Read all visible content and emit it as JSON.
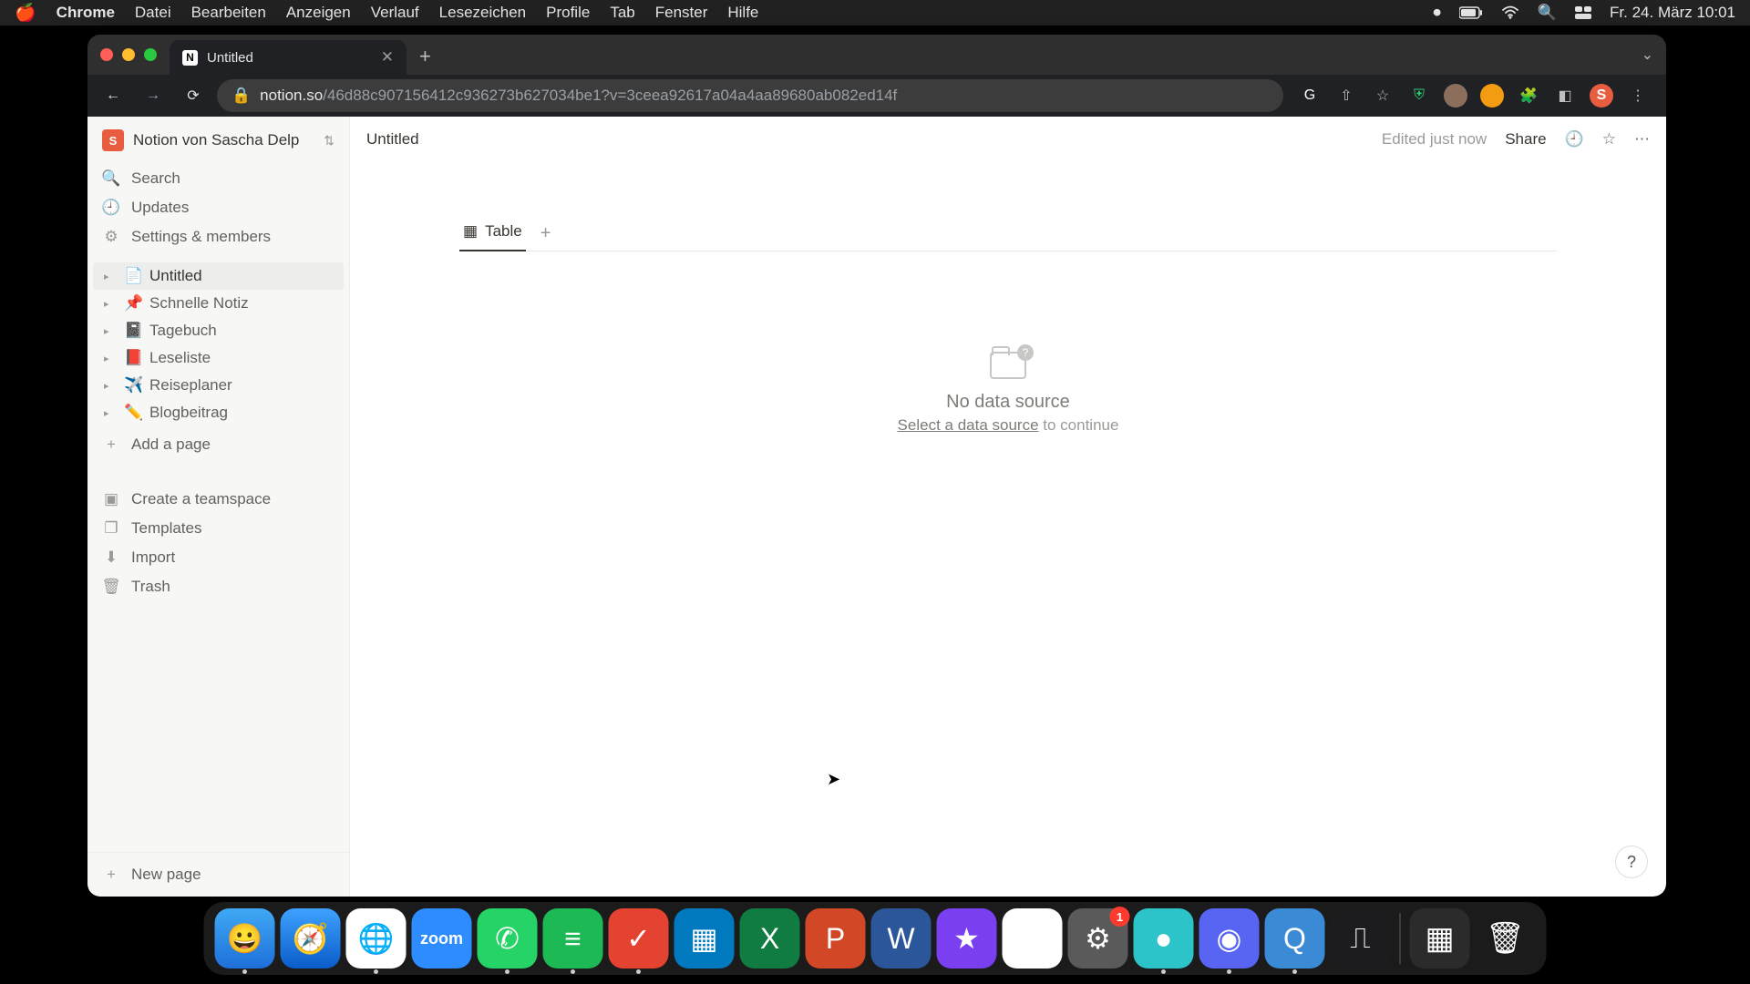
{
  "menubar": {
    "app": "Chrome",
    "items": [
      "Datei",
      "Bearbeiten",
      "Anzeigen",
      "Verlauf",
      "Lesezeichen",
      "Profile",
      "Tab",
      "Fenster",
      "Hilfe"
    ],
    "datetime": "Fr. 24. März  10:01"
  },
  "browser": {
    "tab_title": "Untitled",
    "url_host": "notion.so",
    "url_path": "/46d88c907156412c936273b627034be1?v=3ceea92617a04a4aa89680ab082ed14f"
  },
  "notion": {
    "workspace": "Notion von Sascha Delp",
    "sidebar_top": [
      {
        "icon": "search",
        "label": "Search"
      },
      {
        "icon": "updates",
        "label": "Updates"
      },
      {
        "icon": "settings",
        "label": "Settings & members"
      }
    ],
    "pages": [
      {
        "emoji": "doc",
        "label": "Untitled",
        "active": true
      },
      {
        "emoji": "📌",
        "label": "Schnelle Notiz"
      },
      {
        "emoji": "📓",
        "label": "Tagebuch"
      },
      {
        "emoji": "📕",
        "label": "Leseliste"
      },
      {
        "emoji": "✈️",
        "label": "Reiseplaner"
      },
      {
        "emoji": "✏️",
        "label": "Blogbeitrag"
      }
    ],
    "add_page": "Add a page",
    "sidebar_bottom": [
      {
        "icon": "teamspace",
        "label": "Create a teamspace"
      },
      {
        "icon": "templates",
        "label": "Templates"
      },
      {
        "icon": "import",
        "label": "Import"
      },
      {
        "icon": "trash",
        "label": "Trash"
      }
    ],
    "new_page": "New page",
    "topbar": {
      "title": "Untitled",
      "edited": "Edited just now",
      "share": "Share"
    },
    "view_tab": "Table",
    "empty": {
      "title": "No data source",
      "link": "Select a data source",
      "rest": " to continue"
    }
  },
  "dock": {
    "apps": [
      {
        "name": "Finder",
        "bg": "linear-gradient(#3fa9f5,#1e6fd9)",
        "glyph": "😀",
        "running": true
      },
      {
        "name": "Safari",
        "bg": "linear-gradient(#3ea2ff,#0a5cc9)",
        "glyph": "🧭",
        "running": false
      },
      {
        "name": "Chrome",
        "bg": "#fff",
        "glyph": "🌐",
        "running": true
      },
      {
        "name": "Zoom",
        "bg": "#2d8cff",
        "glyph": "zoom",
        "text": true,
        "running": false
      },
      {
        "name": "WhatsApp",
        "bg": "#25d366",
        "glyph": "✆",
        "running": true
      },
      {
        "name": "Spotify",
        "bg": "#1db954",
        "glyph": "≡",
        "running": true
      },
      {
        "name": "Todoist",
        "bg": "#e44332",
        "glyph": "✓",
        "running": true
      },
      {
        "name": "Trello",
        "bg": "#0079bf",
        "glyph": "▦",
        "running": false
      },
      {
        "name": "Excel",
        "bg": "#107c41",
        "glyph": "X",
        "running": false
      },
      {
        "name": "PowerPoint",
        "bg": "#d24726",
        "glyph": "P",
        "running": false
      },
      {
        "name": "Word",
        "bg": "#2b579a",
        "glyph": "W",
        "running": false
      },
      {
        "name": "iMovie",
        "bg": "#7b3ff2",
        "glyph": "★",
        "running": false
      },
      {
        "name": "Drive",
        "bg": "#fff",
        "glyph": "▲",
        "running": false
      },
      {
        "name": "Settings",
        "bg": "#5a5a5a",
        "glyph": "⚙",
        "badge": "1",
        "running": false
      },
      {
        "name": "App1",
        "bg": "#2cc3c9",
        "glyph": "●",
        "running": true
      },
      {
        "name": "Discord",
        "bg": "#5865f2",
        "glyph": "◉",
        "running": true
      },
      {
        "name": "QuickTime",
        "bg": "#3a8ad6",
        "glyph": "Q",
        "running": true
      },
      {
        "name": "VoiceMemos",
        "bg": "#1c1c1e",
        "glyph": "⎍",
        "running": false
      }
    ],
    "right": [
      {
        "name": "MissionControl",
        "bg": "#2b2b2b",
        "glyph": "▦"
      },
      {
        "name": "Trash",
        "bg": "transparent",
        "glyph": "🗑"
      }
    ]
  }
}
